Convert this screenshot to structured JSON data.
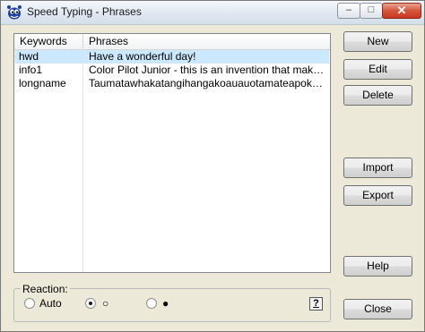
{
  "window": {
    "title": "Speed Typing - Phrases",
    "minimize": "–",
    "maximize": "□",
    "close": "✕"
  },
  "list": {
    "headers": [
      "Keywords",
      "Phrases"
    ],
    "rows": [
      {
        "keyword": "hwd",
        "phrase": "Have a wonderful day!",
        "selected": true
      },
      {
        "keyword": "info1",
        "phrase": "Color Pilot Junior - this is an invention that makes col...",
        "selected": false
      },
      {
        "keyword": "longname",
        "phrase": "Taumatawhakatangihangakoauauotamateapokaiwh...",
        "selected": false
      }
    ]
  },
  "buttons": {
    "new": "New",
    "edit": "Edit",
    "delete": "Delete",
    "import": "Import",
    "export": "Export",
    "help": "Help",
    "close": "Close"
  },
  "reaction": {
    "label": "Reaction:",
    "options": [
      {
        "label": "Auto",
        "selected": false
      },
      {
        "label": "○",
        "selected": true
      },
      {
        "label": "●",
        "selected": false
      }
    ],
    "help_label": "?"
  },
  "colors": {
    "selection": "#cce8ff",
    "window_bg": "#ece9d8",
    "close_button": "#d5553d"
  }
}
